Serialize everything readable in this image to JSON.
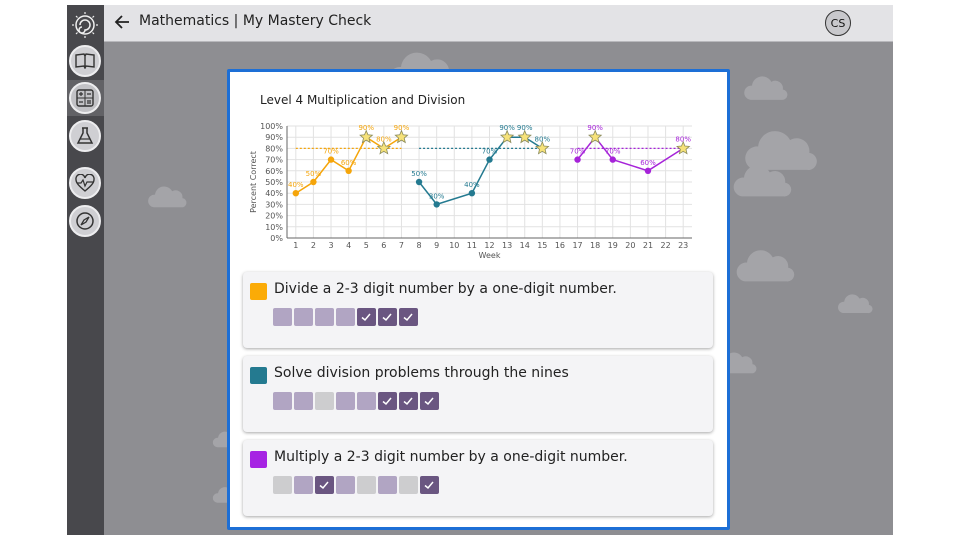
{
  "header": {
    "title": "Mathematics | My Mastery Check",
    "avatar_initials": "CS"
  },
  "sidebar": {
    "items": [
      {
        "name": "logo",
        "icon": "swirl-logo-icon"
      },
      {
        "name": "reading",
        "icon": "open-book-icon"
      },
      {
        "name": "math",
        "icon": "calculator-icon",
        "selected": true
      },
      {
        "name": "science",
        "icon": "flask-icon"
      },
      {
        "name": "health",
        "icon": "heart-pulse-icon"
      },
      {
        "name": "explore",
        "icon": "compass-icon"
      }
    ]
  },
  "modal": {
    "title": "Level 4 Multiplication and Division"
  },
  "chart_data": {
    "type": "line",
    "xlabel": "Week",
    "ylabel": "Percent Correct",
    "x_ticks": [
      "1",
      "2",
      "3",
      "4",
      "5",
      "6",
      "7",
      "8",
      "9",
      "10",
      "11",
      "12",
      "13",
      "14",
      "15",
      "16",
      "17",
      "18",
      "19",
      "20",
      "21",
      "22",
      "23"
    ],
    "y_ticks": [
      "0%",
      "10%",
      "20%",
      "30%",
      "40%",
      "50%",
      "60%",
      "70%",
      "80%",
      "90%",
      "100%"
    ],
    "ylim": [
      0,
      100
    ],
    "xlim": [
      0.5,
      23.5
    ],
    "series": [
      {
        "color": "#f5a50a",
        "target": 80,
        "target_range": [
          1,
          7
        ],
        "points": [
          {
            "x": 1,
            "y": 40,
            "label": "40%"
          },
          {
            "x": 2,
            "y": 50,
            "label": "50%"
          },
          {
            "x": 3,
            "y": 70,
            "label": "70%"
          },
          {
            "x": 4,
            "y": 60,
            "label": "60%"
          },
          {
            "x": 5,
            "y": 90,
            "label": "90%",
            "star": true
          },
          {
            "x": 6,
            "y": 80,
            "label": "80%",
            "star": true
          },
          {
            "x": 7,
            "y": 90,
            "label": "90%",
            "star": true
          }
        ]
      },
      {
        "color": "#247a90",
        "target": 80,
        "target_range": [
          8,
          15
        ],
        "points": [
          {
            "x": 8,
            "y": 50,
            "label": "50%"
          },
          {
            "x": 9,
            "y": 30,
            "label": "30%"
          },
          {
            "x": 11,
            "y": 40,
            "label": "40%"
          },
          {
            "x": 12,
            "y": 70,
            "label": "70%"
          },
          {
            "x": 13,
            "y": 90,
            "label": "90%",
            "star": true
          },
          {
            "x": 14,
            "y": 90,
            "label": "90%",
            "star": true
          },
          {
            "x": 15,
            "y": 80,
            "label": "80%",
            "star": true
          }
        ]
      },
      {
        "color": "#a623d9",
        "target": 80,
        "target_range": [
          17,
          23
        ],
        "points": [
          {
            "x": 17,
            "y": 70,
            "label": "70%"
          },
          {
            "x": 18,
            "y": 90,
            "label": "90%",
            "star": true
          },
          {
            "x": 19,
            "y": 70,
            "label": "70%"
          },
          {
            "x": 21,
            "y": 60,
            "label": "60%"
          },
          {
            "x": 23,
            "y": 80,
            "label": "80%",
            "star": true
          }
        ]
      }
    ]
  },
  "skills": [
    {
      "label": "Divide a 2-3 digit number by a one-digit number.",
      "color": "#fbab07",
      "boxes": [
        "lavender",
        "lavender",
        "lavender",
        "lavender",
        "check",
        "check",
        "check"
      ]
    },
    {
      "label": "Solve division problems through the nines",
      "color": "#247a90",
      "boxes": [
        "lavender",
        "lavender",
        "gray",
        "lavender",
        "lavender",
        "check",
        "check",
        "check"
      ]
    },
    {
      "label": "Multiply a 2-3 digit number by a one-digit number.",
      "color": "#a623e3",
      "boxes": [
        "gray",
        "lavender",
        "check",
        "lavender",
        "gray",
        "lavender",
        "gray",
        "check"
      ]
    }
  ],
  "colors": {
    "lavender": "#b1a5c3",
    "gray": "#cdcdcf",
    "check": "#6a5681",
    "star_fill": "#f6e27a",
    "star_stroke": "#8a8a5a"
  }
}
